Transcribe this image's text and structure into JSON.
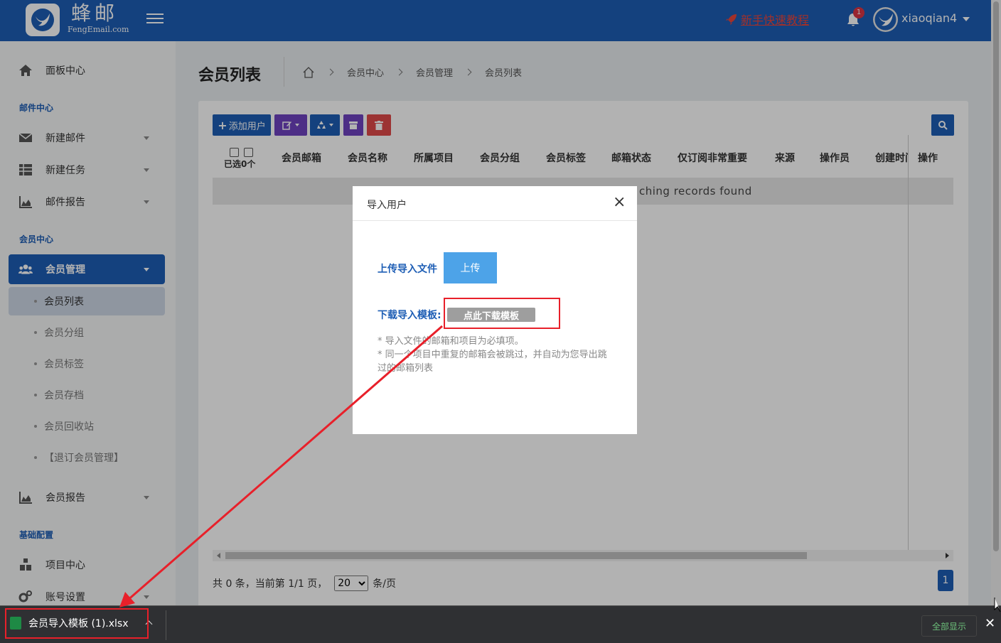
{
  "header": {
    "logo_name": "蜂邮",
    "logo_sub": "FengEmail.com",
    "tutorial_label": "新手快速教程",
    "notification_count": "1",
    "username": "xiaoqian4"
  },
  "sidebar": {
    "dashboard": "面板中心",
    "section_mail": "邮件中心",
    "new_mail": "新建邮件",
    "new_task": "新建任务",
    "mail_report": "邮件报告",
    "section_member": "会员中心",
    "member_manage": "会员管理",
    "sub": [
      "会员列表",
      "会员分组",
      "会员标签",
      "会员存档",
      "会员回收站",
      "【退订会员管理】"
    ],
    "member_report": "会员报告",
    "section_base": "基础配置",
    "project_center": "项目中心",
    "account_settings": "账号设置"
  },
  "page": {
    "title": "会员列表",
    "breadcrumb": [
      "会员中心",
      "会员管理",
      "会员列表"
    ]
  },
  "toolbar": {
    "add_label": "添加用户"
  },
  "table": {
    "selected": "已选0个",
    "columns": [
      "会员邮箱",
      "会员名称",
      "所属项目",
      "会员分组",
      "会员标签",
      "邮箱状态",
      "仅订阅非常重要",
      "来源",
      "操作员",
      "创建时间",
      "操作"
    ],
    "empty_text": "ching records found"
  },
  "pagination": {
    "summary": "共 0 条，当前第 1/1 页，",
    "page_size": "20",
    "per_page_suffix": "条/页",
    "current_page": "1"
  },
  "modal": {
    "title": "导入用户",
    "upload_label": "上传导入文件",
    "upload_button": "上传",
    "download_label": "下载导入模板:",
    "download_button": "点此下载模板",
    "note1": "* 导入文件的邮箱和项目为必填项。",
    "note2": "* 同一个项目中重复的邮箱会被跳过，并自动为您导出跳过的邮箱列表"
  },
  "download_bar": {
    "file_name": "会员导入模板 (1).xlsx",
    "show_all": "全部显示"
  },
  "colors": {
    "primary": "#1e5eb5",
    "danger": "#e04a4a",
    "purple": "#6f42c1",
    "annotation": "#e8202a"
  }
}
